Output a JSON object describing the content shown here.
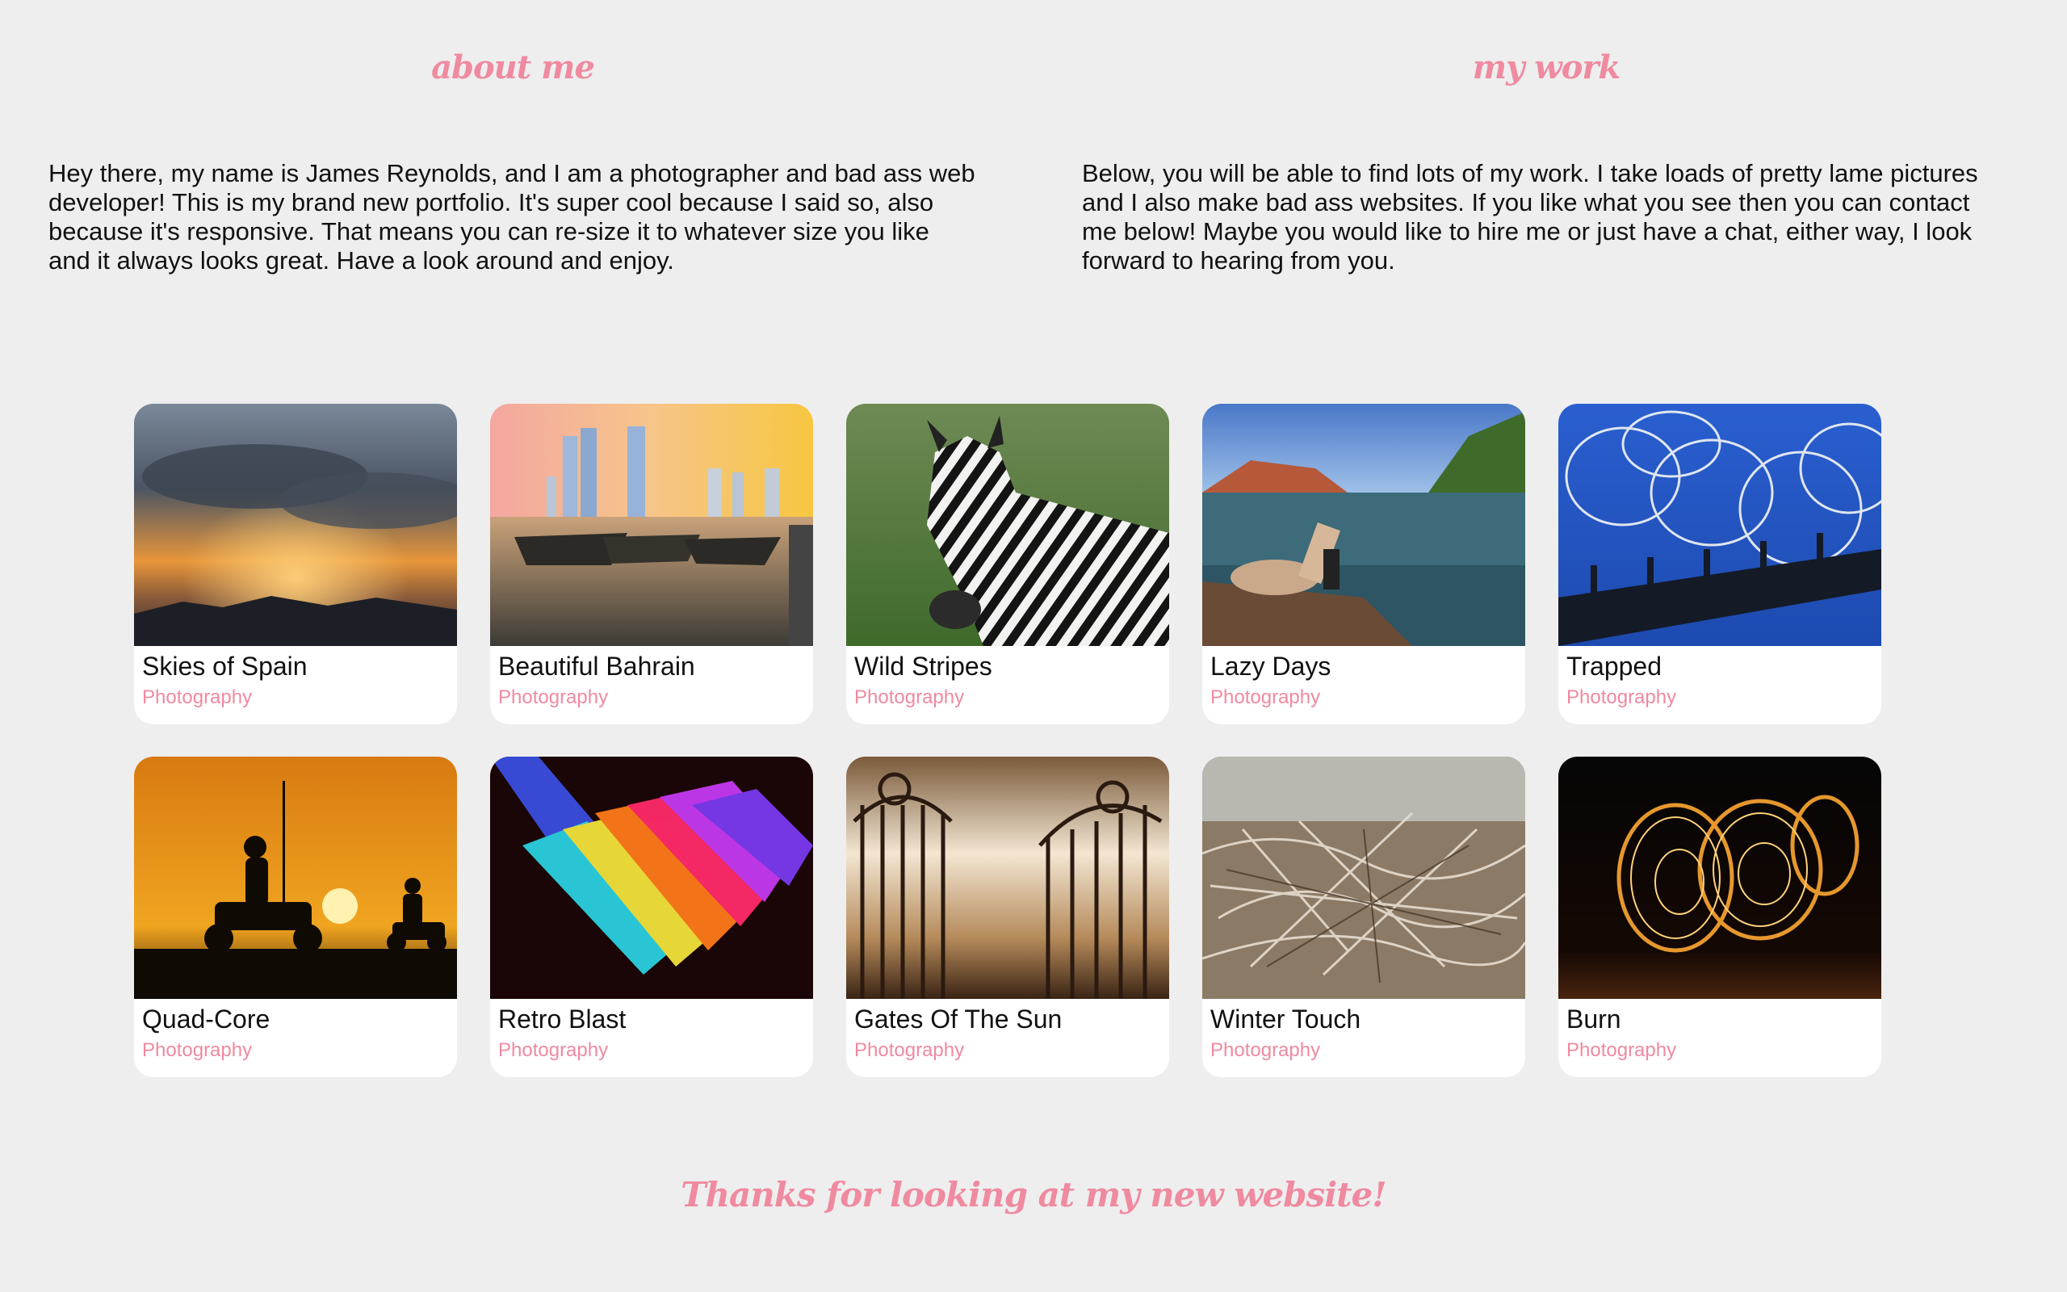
{
  "about": {
    "heading": "about me",
    "text": "Hey there, my name is James Reynolds, and I am a photographer and bad ass web developer! This is my brand new portfolio. It's super cool because I said so, also because it's responsive. That means you can re-size it to whatever size you like and it always looks great. Have a look around and enjoy."
  },
  "work": {
    "heading": "my work",
    "text": "Below, you will be able to find lots of my work. I take loads of pretty lame pictures and I also make bad ass websites. If you like what you see then you can contact me below! Maybe you would like to hire me or just have a chat, either way, I look forward to hearing from you."
  },
  "portfolio": [
    {
      "title": "Skies of Spain",
      "category": "Photography",
      "image": "sunset-clouds-image"
    },
    {
      "title": "Beautiful Bahrain",
      "category": "Photography",
      "image": "harbor-boats-image"
    },
    {
      "title": "Wild Stripes",
      "category": "Photography",
      "image": "zebra-image"
    },
    {
      "title": "Lazy Days",
      "category": "Photography",
      "image": "lake-relaxing-image"
    },
    {
      "title": "Trapped",
      "category": "Photography",
      "image": "barbed-wire-fence-image"
    },
    {
      "title": "Quad-Core",
      "category": "Photography",
      "image": "quad-bike-silhouette-image"
    },
    {
      "title": "Retro Blast",
      "category": "Photography",
      "image": "neon-abstract-image"
    },
    {
      "title": "Gates Of The Sun",
      "category": "Photography",
      "image": "iron-gates-image"
    },
    {
      "title": "Winter Touch",
      "category": "Photography",
      "image": "dry-branches-image"
    },
    {
      "title": "Burn",
      "category": "Photography",
      "image": "fire-spinning-image"
    }
  ],
  "footer": {
    "text": "Thanks for looking at my new website!"
  },
  "colors": {
    "accent": "#ef8aa0",
    "background": "#eeeeee",
    "card": "#ffffff",
    "text": "#111111"
  }
}
